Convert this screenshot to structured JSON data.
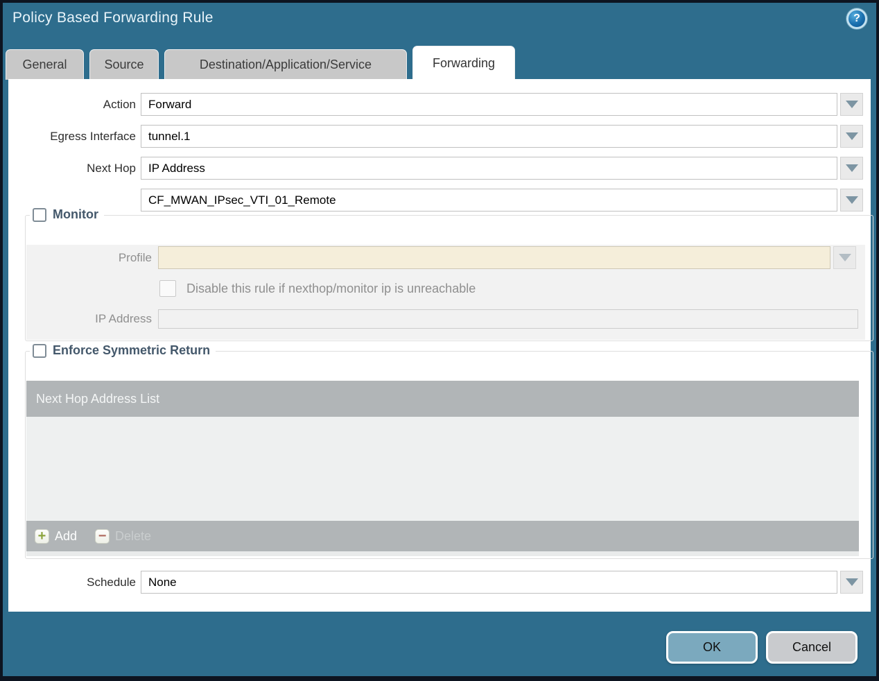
{
  "window": {
    "title": "Policy Based Forwarding Rule"
  },
  "icons": {
    "help": "?",
    "add": "+",
    "delete": "−",
    "dropdown": "▼"
  },
  "tabs": [
    {
      "label": "General",
      "active": false
    },
    {
      "label": "Source",
      "active": false
    },
    {
      "label": "Destination/Application/Service",
      "active": false
    },
    {
      "label": "Forwarding",
      "active": true
    }
  ],
  "form": {
    "action_label": "Action",
    "action_value": "Forward",
    "egress_label": "Egress Interface",
    "egress_value": "tunnel.1",
    "next_hop_label": "Next Hop",
    "next_hop_value": "IP Address",
    "next_hop_address_value": "CF_MWAN_IPsec_VTI_01_Remote",
    "schedule_label": "Schedule",
    "schedule_value": "None"
  },
  "monitor": {
    "legend": "Monitor",
    "checked": false,
    "profile_label": "Profile",
    "profile_value": "",
    "disable_label": "Disable this rule if nexthop/monitor ip is unreachable",
    "disable_checked": false,
    "ip_label": "IP Address",
    "ip_value": ""
  },
  "symmetric": {
    "legend": "Enforce Symmetric Return",
    "checked": false,
    "list_header": "Next Hop Address List",
    "rows": [],
    "add_label": "Add",
    "delete_label": "Delete"
  },
  "footer": {
    "ok": "OK",
    "cancel": "Cancel"
  },
  "colors": {
    "dialog_teal": "#2e6d8d",
    "ok_button": "#7ba9be",
    "cancel_button": "#c9cbce",
    "add_icon_green": "#8ca43d",
    "delete_icon_red": "#b06a5f",
    "profile_field_cream": "#f5eeda",
    "table_gray": "#b1b5b7",
    "legend_slate": "#44586b"
  }
}
